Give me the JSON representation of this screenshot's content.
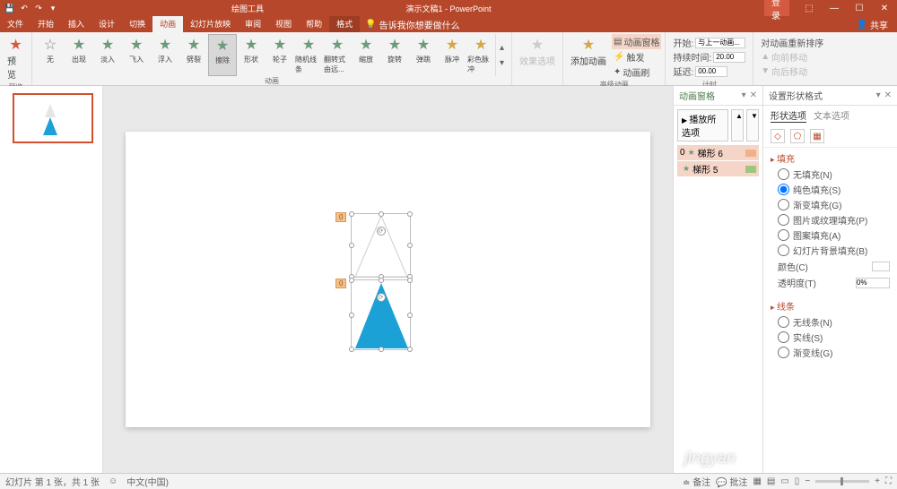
{
  "titlebar": {
    "draw_tools": "绘图工具",
    "title": "演示文稿1 - PowerPoint",
    "login": "登录"
  },
  "tabs": {
    "file": "文件",
    "start": "开始",
    "insert": "插入",
    "design": "设计",
    "transition": "切换",
    "animation": "动画",
    "slideshow": "幻灯片放映",
    "review": "审阅",
    "view": "视图",
    "help": "帮助",
    "format": "格式",
    "tell": "告诉我你想要做什么",
    "share": "共享"
  },
  "ribbon": {
    "preview": "预览",
    "anims": {
      "none": "无",
      "appear": "出现",
      "fade": "淡入",
      "flyin": "飞入",
      "float": "浮入",
      "split": "劈裂",
      "wipe": "擦除",
      "shape": "形状",
      "wheel": "轮子",
      "random": "随机线条",
      "pivot": "翻转式由远...",
      "zoom": "缩放",
      "swivel": "旋转",
      "bounce": "弹跳",
      "pulse": "脉冲",
      "colorpulse": "彩色脉冲"
    },
    "group_anim": "动画",
    "effect_opts": "效果选项",
    "add_anim": "添加动画",
    "anim_pane": "动画窗格",
    "trigger": "触发",
    "painter": "动画刷",
    "group_adv": "高级动画",
    "start": "开始:",
    "start_val": "与上一动画...",
    "duration": "持续时间:",
    "duration_val": "20.00",
    "delay": "延迟:",
    "delay_val": "00.00",
    "reorder": "对动画重新排序",
    "move_fwd": "向前移动",
    "move_back": "向后移动",
    "group_timing": "计时"
  },
  "anim_pane": {
    "title": "动画窗格",
    "play": "播放所选项",
    "items": [
      {
        "idx": "0",
        "star": "★",
        "name": "梯形 6",
        "color": "#f2b088"
      },
      {
        "idx": "",
        "star": "★",
        "name": "梯形 5",
        "color": "#9cc77d"
      }
    ]
  },
  "format_pane": {
    "title": "设置形状格式",
    "tab1": "形状选项",
    "tab2": "文本选项",
    "fill_hdr": "填充",
    "fill_opts": {
      "none": "无填充(N)",
      "solid": "纯色填充(S)",
      "grad": "渐变填充(G)",
      "pic": "图片或纹理填充(P)",
      "pattern": "图案填充(A)",
      "slide": "幻灯片背景填充(B)"
    },
    "color": "颜色(C)",
    "transparency": "透明度(T)",
    "transparency_val": "0%",
    "line_hdr": "线条",
    "line_opts": {
      "none": "无线条(N)",
      "solid": "实线(S)",
      "grad": "渐变线(G)"
    }
  },
  "status": {
    "left": "幻灯片 第 1 张，共 1 张",
    "lang": "中文(中国)",
    "notes": "备注",
    "comments": "批注"
  },
  "canvas": {
    "tag1": "0",
    "tag2": "0"
  },
  "watermark": "jingyan"
}
